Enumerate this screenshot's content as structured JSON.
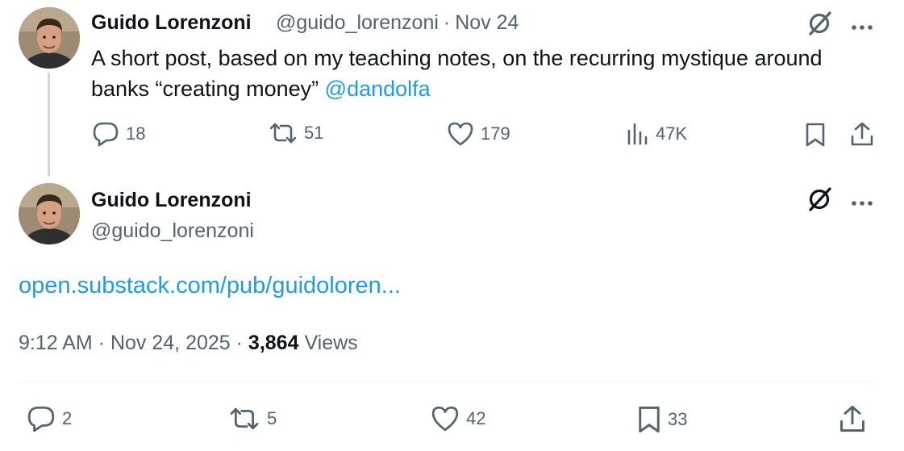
{
  "reply_tweet": {
    "author_name": "Guido Lorenzoni",
    "author_handle": "@guido_lorenzoni",
    "separator": "·",
    "date": "Nov 24",
    "text": "A short post, based on my teaching notes, on the recurring mystique around",
    "text_line2": "banks “creating money”",
    "mention": "@dandolfa",
    "replies": "18",
    "reposts": "51",
    "likes": "179",
    "views": "47K",
    "icons": [
      "grok-icon",
      "more-icon",
      "reply-icon",
      "repost-icon",
      "like-icon",
      "views-icon",
      "bookmark-icon",
      "share-icon"
    ]
  },
  "main_tweet": {
    "author_name": "Guido Lorenzoni",
    "author_handle": "@guido_lorenzoni",
    "link_text": "open.substack.com/pub/guidoloren...",
    "time": "9:12 AM",
    "separator": "·",
    "date": "Nov 24, 2025",
    "views_count": "3,864",
    "views_label": "Views",
    "replies": "2",
    "reposts": "5",
    "likes": "42",
    "bookmarks": "33"
  },
  "colors": {
    "link": "#1d9bf0",
    "text": "#0f1419",
    "secondary": "#536471",
    "thread_line": "#cfd9de",
    "divider": "#eff3f4"
  }
}
